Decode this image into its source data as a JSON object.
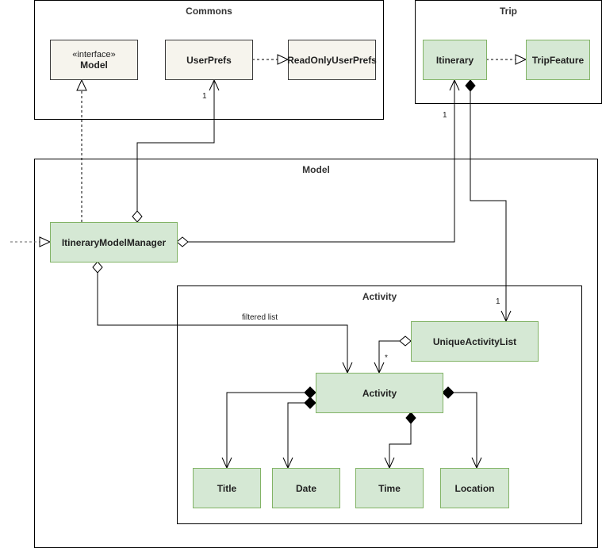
{
  "diagram": {
    "type": "uml-class-diagram",
    "packages": {
      "commons": {
        "title": "Commons"
      },
      "trip": {
        "title": "Trip"
      },
      "model": {
        "title": "Model"
      },
      "activity": {
        "title": "Activity"
      }
    },
    "classes": {
      "model_interface": {
        "stereotype": "«interface»",
        "name": "Model"
      },
      "user_prefs": {
        "name": "UserPrefs"
      },
      "read_only_user_prefs": {
        "name": "ReadOnlyUserPrefs"
      },
      "itinerary": {
        "name": "Itinerary"
      },
      "trip_feature": {
        "name": "TripFeature"
      },
      "itinerary_model_manager": {
        "name": "ItineraryModelManager"
      },
      "unique_activity_list": {
        "name": "UniqueActivityList"
      },
      "activity": {
        "name": "Activity"
      },
      "title": {
        "name": "Title"
      },
      "date": {
        "name": "Date"
      },
      "time": {
        "name": "Time"
      },
      "location": {
        "name": "Location"
      }
    },
    "relationships": [
      {
        "from": "UserPrefs",
        "to": "ReadOnlyUserPrefs",
        "kind": "realization"
      },
      {
        "from": "Itinerary",
        "to": "TripFeature",
        "kind": "realization"
      },
      {
        "from": "ItineraryModelManager",
        "to": "Model",
        "kind": "realization"
      },
      {
        "from": "ItineraryModelManager",
        "to": "UserPrefs",
        "kind": "aggregation",
        "multiplicity": "1"
      },
      {
        "from": "ItineraryModelManager",
        "to": "Itinerary",
        "kind": "aggregation",
        "multiplicity": "1"
      },
      {
        "from": "ItineraryModelManager",
        "to": "Activity",
        "kind": "aggregation",
        "label": "filtered list"
      },
      {
        "from": "Itinerary",
        "to": "UniqueActivityList",
        "kind": "composition",
        "multiplicity": "1"
      },
      {
        "from": "UniqueActivityList",
        "to": "Activity",
        "kind": "aggregation",
        "multiplicity": "*"
      },
      {
        "from": "Activity",
        "to": "Title",
        "kind": "composition"
      },
      {
        "from": "Activity",
        "to": "Date",
        "kind": "composition"
      },
      {
        "from": "Activity",
        "to": "Time",
        "kind": "composition"
      },
      {
        "from": "Activity",
        "to": "Location",
        "kind": "composition"
      }
    ],
    "labels": {
      "userprefs_mult": "1",
      "itinerary_mult": "1",
      "ual_mult": "1",
      "activity_mult": "*",
      "filtered_list": "filtered list"
    }
  }
}
